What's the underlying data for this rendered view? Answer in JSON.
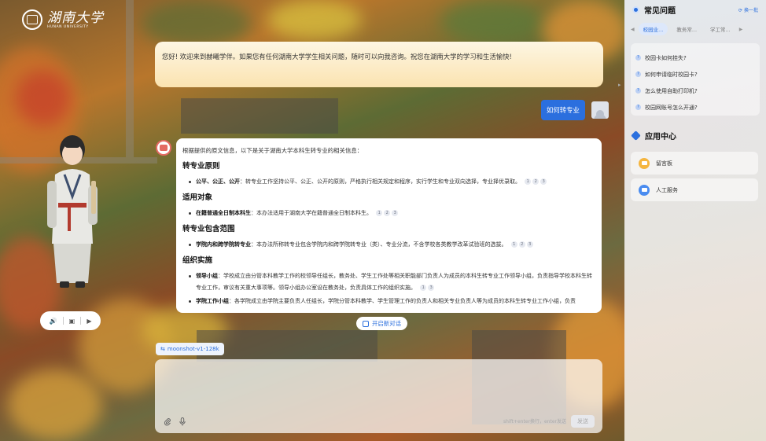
{
  "logo": {
    "cn": "湖南大学",
    "en": "HUNAN UNIVERSITY"
  },
  "welcome": {
    "text": "您好! 欢迎来到赫曦学伴。如果您有任何湖南大学学生相关问题，随时可以向我咨询。祝您在湖南大学的学习和生活愉快!"
  },
  "user_message": {
    "text": "如何转专业"
  },
  "answer": {
    "intro": "根据提供的原文信息，以下是关于湖南大学本科生转专业的相关信息：",
    "sections": [
      {
        "title": "转专业原则",
        "bullets": [
          {
            "bold": "公平、公正、公开",
            "text": "：转专业工作坚持公平、公正、公开的原则，严格执行相关规定和程序，实行学生和专业双向选择，专业择优录取。",
            "refs": [
              "1",
              "2",
              "3"
            ]
          }
        ]
      },
      {
        "title": "适用对象",
        "bullets": [
          {
            "bold": "在籍普通全日制本科生",
            "text": "：本办法适用于湖南大学在籍普通全日制本科生。",
            "refs": [
              "1",
              "2",
              "3"
            ]
          }
        ]
      },
      {
        "title": "转专业包含范围",
        "bullets": [
          {
            "bold": "学院内和跨学院转专业",
            "text": "：本办法所称转专业包含学院内和跨学院转专业（类）、专业分流，不含学校各类教学改革试验班的选拔。",
            "refs": [
              "1",
              "2",
              "3"
            ]
          }
        ]
      },
      {
        "title": "组织实施",
        "bullets": [
          {
            "bold": "领导小组",
            "text": "：学校成立由分管本科教学工作的校领导任组长，教务处、学生工作处等相关职能部门负责人为成员的本科生转专业工作领导小组，负责指导学校本科生转专业工作，审议有关重大事项等。领导小组办公室设在教务处，负责具体工作的组织实施。",
            "refs": [
              "1",
              "3"
            ]
          },
          {
            "bold": "学院工作小组",
            "text": "：各学院成立由学院主要负责人任组长，学院分管本科教学、学生管理工作的负责人和相关专业负责人等为成员的本科生转专业工作小组，负责",
            "refs": []
          }
        ]
      }
    ]
  },
  "new_chat": {
    "label": "开启新对话"
  },
  "model": {
    "label": "moonshot-v1-128k"
  },
  "input": {
    "placeholder": "",
    "hint": "shift+enter换行，enter发送",
    "send_label": "发送"
  },
  "panel": {
    "faq_title": "常见问题",
    "refresh_label": "换一批",
    "tabs": [
      {
        "label": "校园业..."
      },
      {
        "label": "教务常..."
      },
      {
        "label": "学工常..."
      }
    ],
    "faqs": [
      {
        "q": "校园卡如何挂失?"
      },
      {
        "q": "如何申请临时校园卡?"
      },
      {
        "q": "怎么使用自助打印机?"
      },
      {
        "q": "校园网账号怎么开通?"
      }
    ],
    "apps_title": "应用中心",
    "apps": [
      {
        "label": "留言板"
      },
      {
        "label": "人工服务"
      }
    ]
  },
  "colors": {
    "accent": "#2b6fde",
    "banner": "#fbe3b0",
    "send_disabled": "#e7e8ec"
  }
}
